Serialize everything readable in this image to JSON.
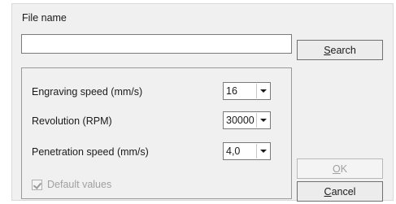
{
  "file": {
    "label": "File name",
    "value": "",
    "placeholder": ""
  },
  "buttons": {
    "search": {
      "mnemonic": "S",
      "rest": "earch"
    },
    "ok": {
      "mnemonic": "O",
      "rest": "K"
    },
    "cancel": {
      "mnemonic": "C",
      "rest": "ancel"
    }
  },
  "settings": {
    "engraving_speed": {
      "label": "Engraving speed (mm/s)",
      "value": "16"
    },
    "revolution": {
      "label": "Revolution (RPM)",
      "value": "30000"
    },
    "penetration_speed": {
      "label": "Penetration speed (mm/s)",
      "value": "4,0"
    }
  },
  "defaults": {
    "label": "Default values",
    "checked": true,
    "enabled": false
  }
}
